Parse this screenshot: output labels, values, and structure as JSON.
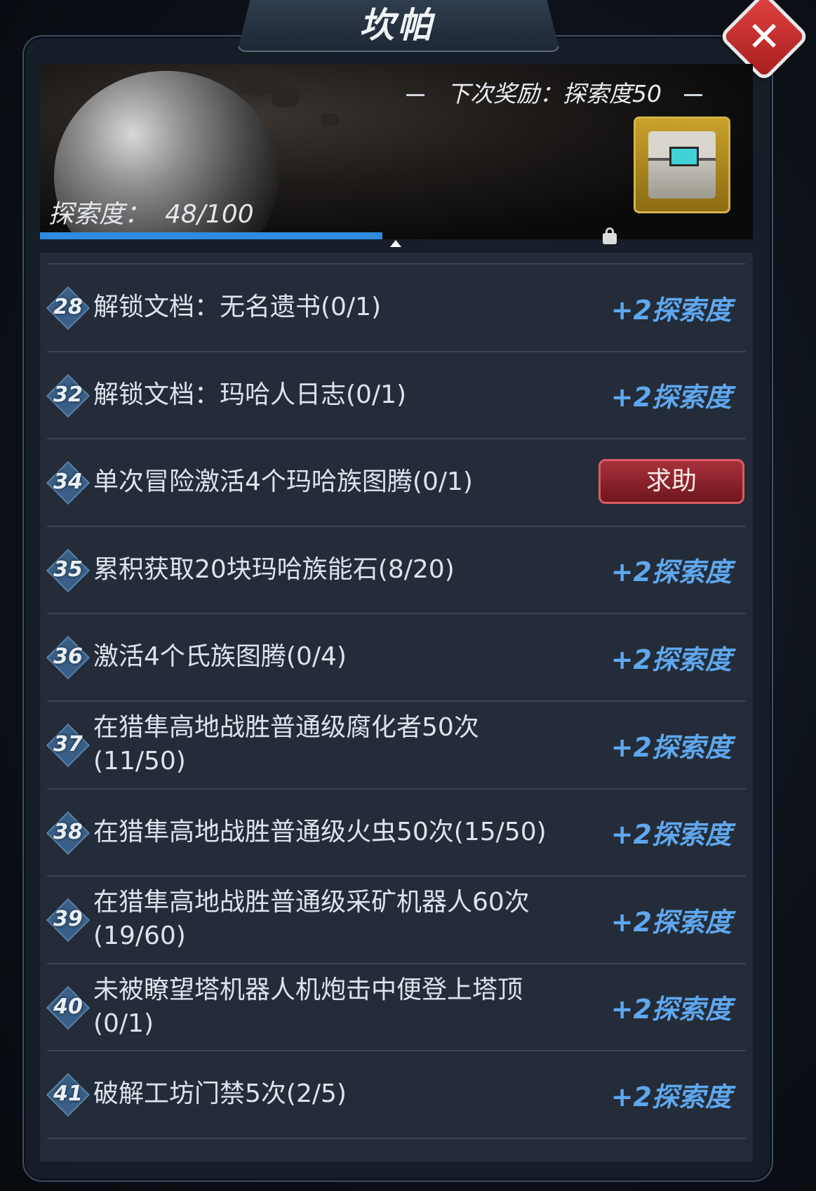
{
  "window": {
    "title": "坎帕",
    "close_icon": "close-icon"
  },
  "banner": {
    "next_reward": "下次奖励：探索度50",
    "explore_label": "探索度：",
    "explore_value": "48/100",
    "explore_progress_fraction": 0.48,
    "reward_icon": "supply-crate-icon",
    "locked_icon": "lock-icon",
    "progress_color": "#2f8be0"
  },
  "tasks": [
    {
      "num": "28",
      "text": "解锁文档：无名遗书(0/1)",
      "reward": "+2探索度"
    },
    {
      "num": "32",
      "text": "解锁文档：玛哈人日志(0/1)",
      "reward": "+2探索度"
    },
    {
      "num": "34",
      "text": "单次冒险激活4个玛哈族图腾(0/1)",
      "button": "求助"
    },
    {
      "num": "35",
      "text": "累积获取20块玛哈族能石(8/20)",
      "reward": "+2探索度"
    },
    {
      "num": "36",
      "text": "激活4个氏族图腾(0/4)",
      "reward": "+2探索度"
    },
    {
      "num": "37",
      "text": "在猎隼高地战胜普通级腐化者50次(11/50)",
      "reward": "+2探索度"
    },
    {
      "num": "38",
      "text": "在猎隼高地战胜普通级火虫50次(15/50)",
      "reward": "+2探索度"
    },
    {
      "num": "39",
      "text": "在猎隼高地战胜普通级采矿机器人60次(19/60)",
      "reward": "+2探索度"
    },
    {
      "num": "40",
      "text": "未被瞭望塔机器人机炮击中便登上塔顶(0/1)",
      "reward": "+2探索度"
    },
    {
      "num": "41",
      "text": "破解工坊门禁5次(2/5)",
      "reward": "+2探索度"
    }
  ],
  "colors": {
    "reward_text": "#5fa7ee",
    "help_button": "#a9313a"
  }
}
